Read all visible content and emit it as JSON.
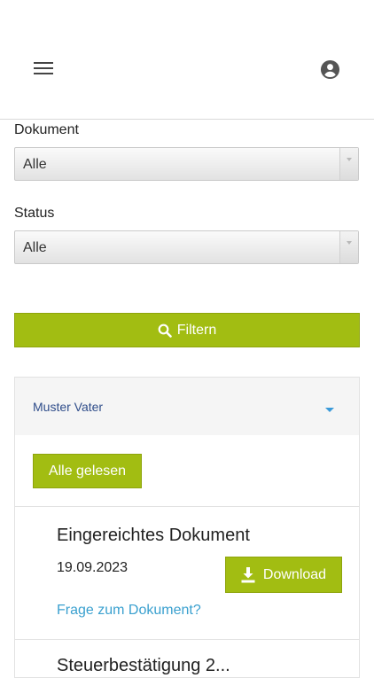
{
  "header": {
    "menu_icon": "hamburger-menu-icon",
    "user_icon": "user-circle-icon"
  },
  "filters": {
    "document_label": "Dokument",
    "document_value": "Alle",
    "status_label": "Status",
    "status_value": "Alle",
    "filter_button": "Filtern",
    "filter_icon": "search-icon"
  },
  "group": {
    "name": "Muster Vater",
    "mark_all_read": "Alle gelesen",
    "documents": [
      {
        "title": "Eingereichtes Dokument",
        "date": "19.09.2023",
        "download": "Download",
        "question_link": "Frage zum Dokument?"
      },
      {
        "title": "Steuerbestätigung 2..."
      }
    ]
  },
  "colors": {
    "accent": "#a2bd12",
    "link": "#3aa0cf",
    "name": "#2f4d8a"
  }
}
